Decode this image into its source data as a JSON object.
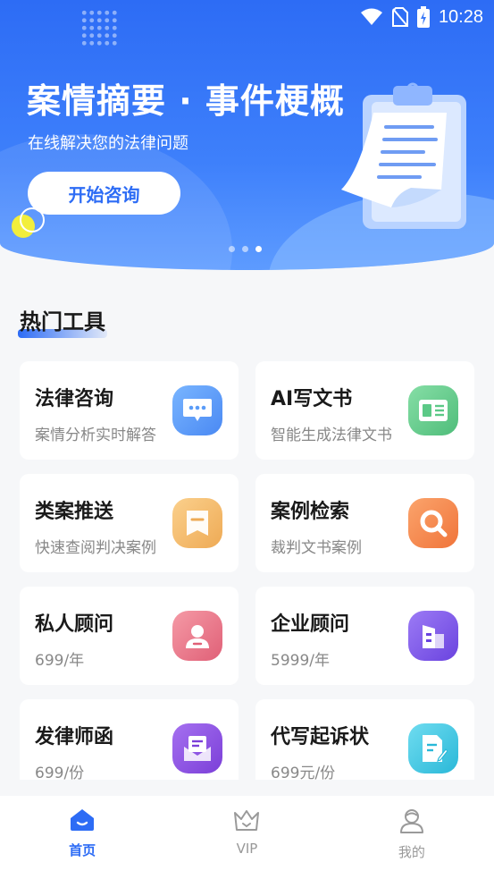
{
  "status_bar": {
    "time": "10:28"
  },
  "banner": {
    "title": "案情摘要 · 事件梗概",
    "subtitle": "在线解决您的法律问题",
    "button_label": "开始咨询",
    "pages": 3,
    "active_page": 3
  },
  "section": {
    "title": "热门工具"
  },
  "tools": [
    {
      "title": "法律咨询",
      "subtitle": "案情分析实时解答",
      "icon": "chat-bubble-icon",
      "color": "#5a9cf8"
    },
    {
      "title": "AI写文书",
      "subtitle": "智能生成法律文书",
      "icon": "document-icon",
      "color": "#5cc987"
    },
    {
      "title": "类案推送",
      "subtitle": "快速查阅判决案例",
      "icon": "bookmark-icon",
      "color": "#f2b865"
    },
    {
      "title": "案例检索",
      "subtitle": "裁判文书案例",
      "icon": "search-icon",
      "color": "#f58a4c"
    },
    {
      "title": "私人顾问",
      "subtitle": "699/年",
      "icon": "person-icon",
      "color": "#ec6f84"
    },
    {
      "title": "企业顾问",
      "subtitle": "5999/年",
      "icon": "building-icon",
      "color": "#7b59e8"
    },
    {
      "title": "发律师函",
      "subtitle": "699/份",
      "icon": "letter-icon",
      "color": "#8b4fe0"
    },
    {
      "title": "代写起诉状",
      "subtitle": "699元/份",
      "icon": "write-icon",
      "color": "#3dc8e3"
    }
  ],
  "tabbar": {
    "items": [
      {
        "label": "首页",
        "icon": "home-icon",
        "active": true
      },
      {
        "label": "VIP",
        "icon": "crown-icon",
        "active": false
      },
      {
        "label": "我的",
        "icon": "profile-icon",
        "active": false
      }
    ]
  }
}
